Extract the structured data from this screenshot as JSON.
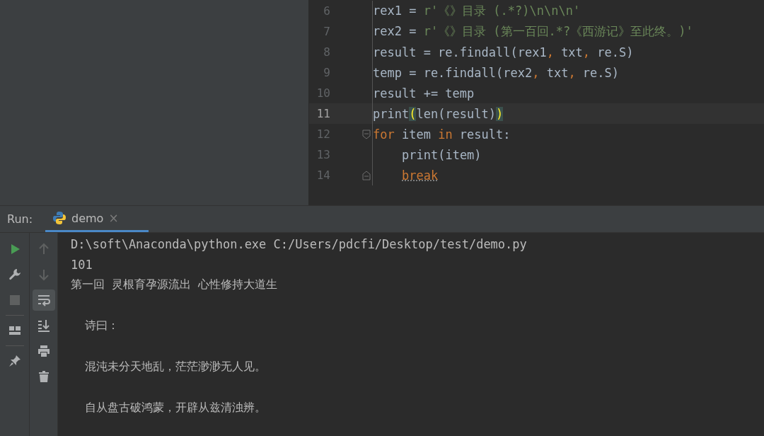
{
  "editor": {
    "lines": [
      {
        "number": "6",
        "current": false,
        "kind": "code",
        "indented": false,
        "tokens": [
          {
            "kind": "plain",
            "text": "rex1 = "
          },
          {
            "kind": "string",
            "text": "r'《》目录 (.*?)\\n\\n\\n'"
          }
        ]
      },
      {
        "number": "7",
        "current": false,
        "kind": "code",
        "indented": false,
        "tokens": [
          {
            "kind": "plain",
            "text": "rex2 = "
          },
          {
            "kind": "string",
            "text": "r'《》目录 (第一百回.*?《西游记》至此终。)'"
          }
        ]
      },
      {
        "number": "8",
        "current": false,
        "kind": "code",
        "indented": false,
        "tokens": [
          {
            "kind": "plain",
            "text": "result = re.findall(rex1"
          },
          {
            "kind": "comma",
            "text": ","
          },
          {
            "kind": "plain",
            "text": " txt"
          },
          {
            "kind": "comma",
            "text": ","
          },
          {
            "kind": "plain",
            "text": " re.S)"
          }
        ]
      },
      {
        "number": "9",
        "current": false,
        "kind": "code",
        "indented": false,
        "tokens": [
          {
            "kind": "plain",
            "text": "temp = re.findall(rex2"
          },
          {
            "kind": "comma",
            "text": ","
          },
          {
            "kind": "plain",
            "text": " txt"
          },
          {
            "kind": "comma",
            "text": ","
          },
          {
            "kind": "plain",
            "text": " re.S)"
          }
        ]
      },
      {
        "number": "10",
        "current": false,
        "kind": "code",
        "indented": false,
        "tokens": [
          {
            "kind": "plain",
            "text": "result += temp"
          }
        ]
      },
      {
        "number": "11",
        "current": true,
        "kind": "code",
        "indented": false,
        "tokens": [
          {
            "kind": "plain",
            "text": "print"
          },
          {
            "kind": "match",
            "text": "("
          },
          {
            "kind": "plain",
            "text": "len(result)"
          },
          {
            "kind": "match",
            "text": ")"
          }
        ]
      },
      {
        "number": "12",
        "current": false,
        "kind": "fold-start",
        "indented": false,
        "tokens": [
          {
            "kind": "keyword",
            "text": "for"
          },
          {
            "kind": "plain",
            "text": " item "
          },
          {
            "kind": "keyword",
            "text": "in"
          },
          {
            "kind": "plain",
            "text": " result:"
          }
        ]
      },
      {
        "number": "13",
        "current": false,
        "kind": "code",
        "indented": true,
        "tokens": [
          {
            "kind": "plain",
            "text": "print(item)"
          }
        ]
      },
      {
        "number": "14",
        "current": false,
        "kind": "fold-end",
        "indented": true,
        "tokens": [
          {
            "kind": "warning",
            "text": "break"
          }
        ]
      }
    ]
  },
  "run_panel": {
    "label": "Run:",
    "tabs": [
      {
        "label": "demo",
        "selected": true,
        "close": "×"
      }
    ]
  },
  "toolbar_left": [
    {
      "kind": "run",
      "disabled": false
    },
    {
      "kind": "wrench",
      "disabled": false
    },
    {
      "kind": "stop",
      "disabled": true
    },
    {
      "kind": "layout",
      "disabled": false
    },
    {
      "kind": "pin",
      "disabled": false
    }
  ],
  "toolbar_right": [
    {
      "kind": "up",
      "disabled": true,
      "selected": false
    },
    {
      "kind": "down",
      "disabled": true,
      "selected": false
    },
    {
      "kind": "wrap",
      "disabled": false,
      "selected": true
    },
    {
      "kind": "scroll-end",
      "disabled": false,
      "selected": false
    },
    {
      "kind": "print",
      "disabled": false,
      "selected": false
    },
    {
      "kind": "trash",
      "disabled": false,
      "selected": false
    }
  ],
  "console": [
    {
      "kind": "mono",
      "text": "D:\\soft\\Anaconda\\python.exe C:/Users/pdcfi/Desktop/test/demo.py"
    },
    {
      "kind": "mono",
      "text": "101"
    },
    {
      "kind": "cjk",
      "text": "第一回  灵根育孕源流出  心性修持大道生"
    },
    {
      "kind": "blank"
    },
    {
      "kind": "cjk",
      "text": "    诗曰："
    },
    {
      "kind": "blank"
    },
    {
      "kind": "cjk",
      "text": "    混沌未分天地乱，茫茫渺渺无人见。"
    },
    {
      "kind": "blank"
    },
    {
      "kind": "cjk",
      "text": "    自从盘古破鸿蒙，开辟从兹清浊辨。"
    }
  ]
}
